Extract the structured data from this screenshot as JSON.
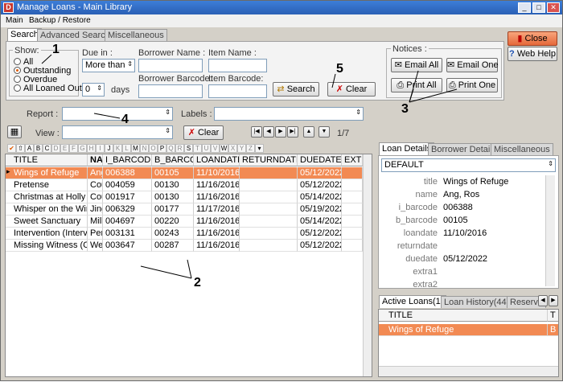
{
  "window": {
    "title": "Manage Loans - Main Library",
    "app_icon": "D"
  },
  "menu": [
    "Main",
    "Backup / Restore"
  ],
  "top_tabs": [
    "Search",
    "Advanced Search",
    "Miscellaneous"
  ],
  "show": {
    "label": "Show:",
    "options": [
      "All",
      "Outstanding",
      "Overdue",
      "All Loaned Out"
    ],
    "selected": "Outstanding"
  },
  "due_in": {
    "label": "Due in :",
    "mode": "More than",
    "value": "0",
    "unit": "days"
  },
  "borrower_name": {
    "label": "Borrower Name :",
    "value": ""
  },
  "item_name": {
    "label": "Item Name :",
    "value": ""
  },
  "borrower_barcode": {
    "label": "Borrower Barcode:",
    "value": ""
  },
  "item_barcode": {
    "label": "Item Barcode:",
    "value": ""
  },
  "buttons": {
    "search": "Search",
    "clear": "Clear",
    "close": "Close",
    "help": "Web Help",
    "clear2": "Clear"
  },
  "notices": {
    "label": "Notices :",
    "email_all": "Email All",
    "email_one": "Email One",
    "print_all": "Print All",
    "print_one": "Print One"
  },
  "report": {
    "label": "Report :",
    "value": ""
  },
  "labels": {
    "label": "Labels :",
    "value": ""
  },
  "view": {
    "label": "View :",
    "value": ""
  },
  "pager": "1/7",
  "alphabet": [
    "A",
    "B",
    "C",
    "D",
    "E",
    "F",
    "G",
    "H",
    "I",
    "J",
    "K",
    "L",
    "M",
    "N",
    "O",
    "P",
    "Q",
    "R",
    "S",
    "T",
    "U",
    "V",
    "W",
    "X",
    "Y",
    "Z"
  ],
  "callouts": [
    "1",
    "2",
    "3",
    "4",
    "5"
  ],
  "loans_table": {
    "columns": [
      "TITLE",
      "NA",
      "I_BARCODE",
      "B_BARCOD",
      "LOANDATE",
      "RETURNDATE",
      "DUEDATE",
      "EXTR"
    ],
    "rows": [
      [
        "Wings of Refuge",
        "Ang",
        "006388",
        "00105",
        "11/10/2016",
        "",
        "05/12/2022",
        ""
      ],
      [
        "Pretense",
        "Cou",
        "004059",
        "00130",
        "11/16/2016",
        "",
        "05/12/2022",
        ""
      ],
      [
        "Christmas at Holly Hi",
        "Cou",
        "001917",
        "00130",
        "11/16/2016",
        "",
        "05/14/2022",
        ""
      ],
      [
        "Whisper on the Winc",
        "Jing",
        "006329",
        "00177",
        "11/17/2016",
        "",
        "05/19/2022",
        ""
      ],
      [
        "Sweet Sanctuary",
        "Mill",
        "004697",
        "00220",
        "11/16/2016",
        "",
        "05/14/2022",
        ""
      ],
      [
        "Intervention (Interve",
        "Pen",
        "003131",
        "00243",
        "11/16/2016",
        "",
        "05/12/2022",
        ""
      ],
      [
        "Missing Witness (Cha",
        "Wel",
        "003647",
        "00287",
        "11/16/2016",
        "",
        "05/12/2022",
        ""
      ]
    ]
  },
  "detail_tabs": [
    "Loan Details",
    "Borrower Details",
    "Miscellaneous"
  ],
  "detail_profile": "DEFAULT",
  "details": [
    {
      "key": "title",
      "value": "Wings of Refuge"
    },
    {
      "key": "name",
      "value": "Ang, Ros"
    },
    {
      "key": "i_barcode",
      "value": "006388"
    },
    {
      "key": "b_barcode",
      "value": "00105"
    },
    {
      "key": "loandate",
      "value": "11/10/2016"
    },
    {
      "key": "returndate",
      "value": ""
    },
    {
      "key": "duedate",
      "value": "05/12/2022"
    },
    {
      "key": "extra1",
      "value": ""
    },
    {
      "key": "extra2",
      "value": ""
    }
  ],
  "bottom_tabs": [
    "Active Loans(1)",
    "Loan History(44)",
    "Reserva"
  ],
  "active_loans": {
    "columns": [
      "TITLE",
      "T"
    ],
    "rows": [
      [
        "Wings of Refuge",
        "B"
      ]
    ]
  }
}
